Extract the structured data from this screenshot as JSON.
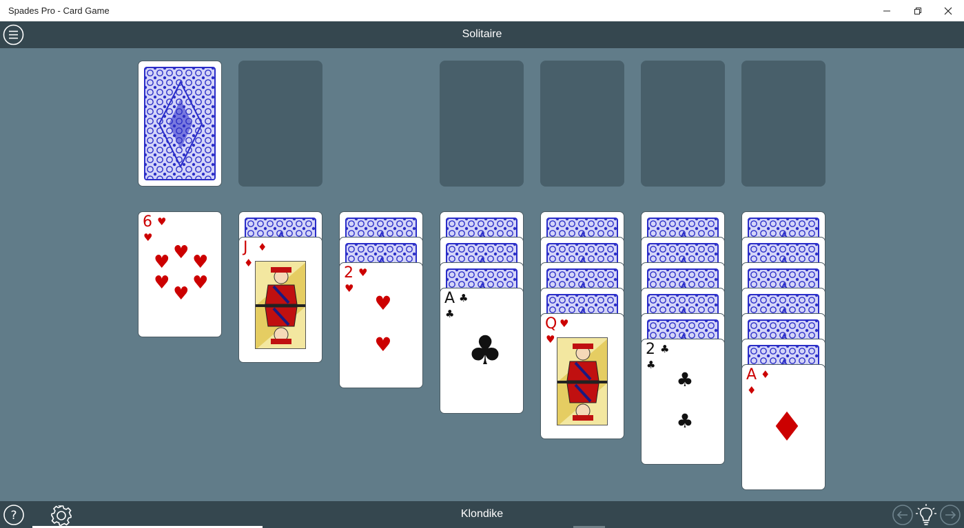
{
  "window": {
    "title": "Spades Pro - Card Game",
    "minimize_icon": "minimize-icon",
    "restore_icon": "restore-icon",
    "close_icon": "close-icon"
  },
  "header": {
    "mode": "Solitaire",
    "menu_icon": "hamburger-menu-icon"
  },
  "footer": {
    "variant": "Klondike",
    "help_icon": "help-icon",
    "settings_icon": "gear-icon",
    "undo_icon": "arrow-left-icon",
    "hint_icon": "lightbulb-icon",
    "redo_icon": "arrow-right-icon"
  },
  "colors": {
    "felt": "#617c89",
    "bar": "#35474f",
    "slot": "#485f6a",
    "card_back": "#2b2ec8",
    "red_suit": "#cc0000",
    "black_suit": "#111111"
  },
  "board": {
    "stock": {
      "face_down": true
    },
    "waste": {
      "empty": true
    },
    "foundations": [
      {
        "empty": true
      },
      {
        "empty": true
      },
      {
        "empty": true
      },
      {
        "empty": true
      }
    ],
    "tableau": [
      {
        "face_down": 0,
        "top": {
          "rank": "6",
          "suit": "♥",
          "color": "red"
        }
      },
      {
        "face_down": 1,
        "top": {
          "rank": "J",
          "suit": "♦",
          "color": "red"
        }
      },
      {
        "face_down": 2,
        "top": {
          "rank": "2",
          "suit": "♥",
          "color": "red"
        }
      },
      {
        "face_down": 3,
        "top": {
          "rank": "A",
          "suit": "♣",
          "color": "black"
        }
      },
      {
        "face_down": 4,
        "top": {
          "rank": "Q",
          "suit": "♥",
          "color": "red"
        }
      },
      {
        "face_down": 5,
        "top": {
          "rank": "2",
          "suit": "♣",
          "color": "black"
        }
      },
      {
        "face_down": 6,
        "top": {
          "rank": "A",
          "suit": "♦",
          "color": "red"
        }
      }
    ]
  }
}
